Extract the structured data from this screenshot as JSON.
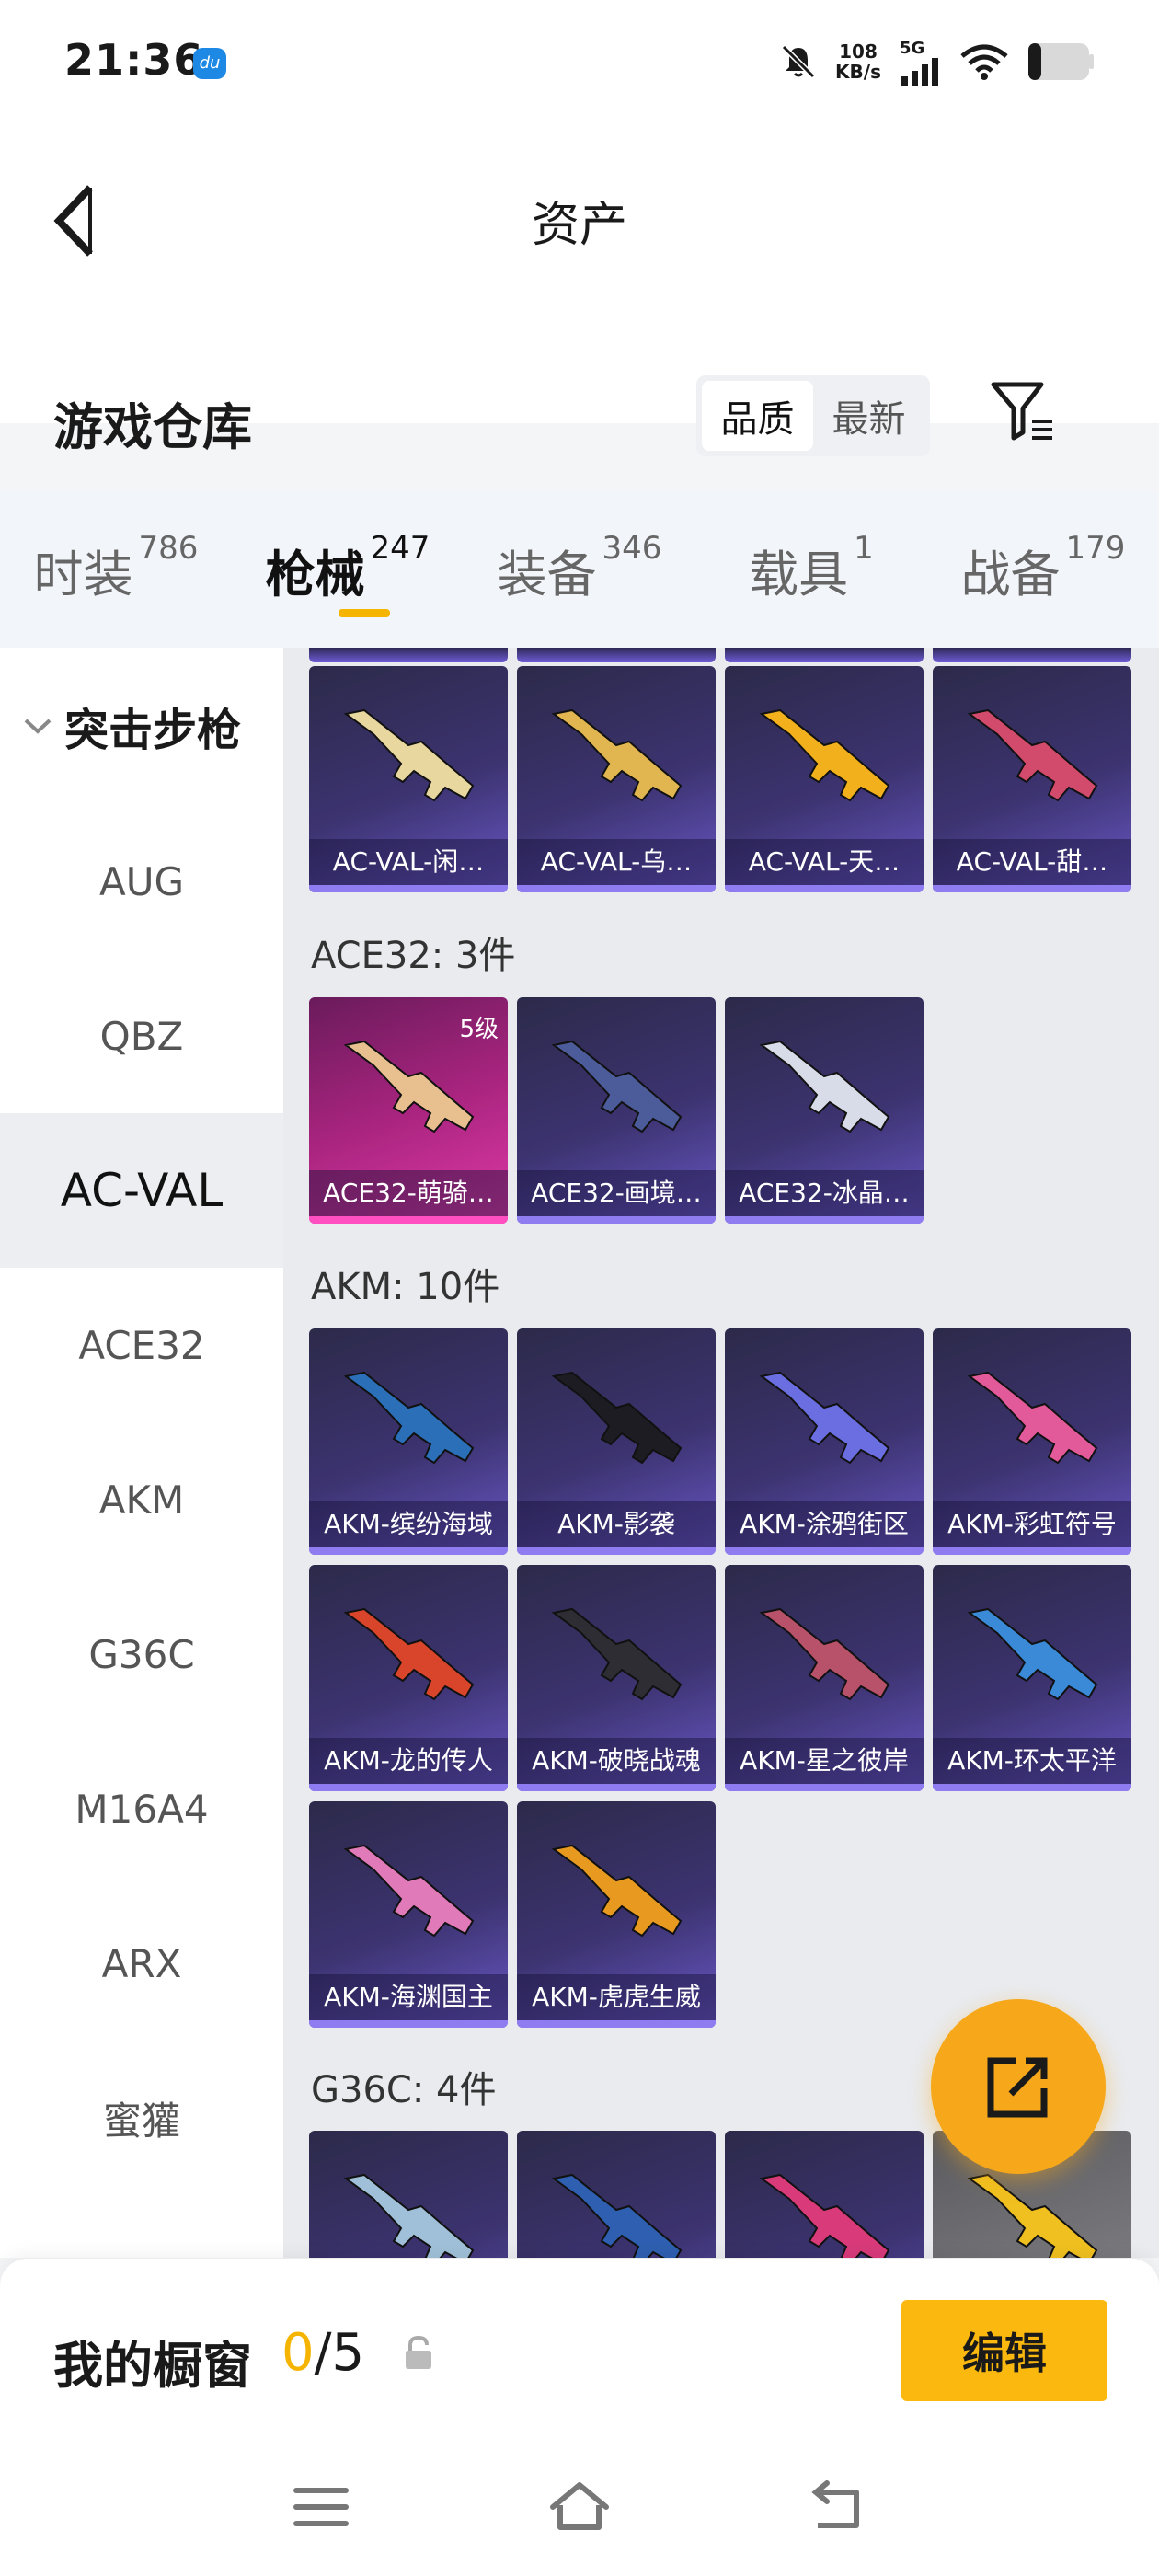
{
  "status_bar": {
    "time": "21:36",
    "net_speed_value": "108",
    "net_speed_unit": "KB/s",
    "network": "5G",
    "app_icon": "du"
  },
  "header": {
    "title": "资产",
    "section_title": "游戏仓库",
    "sort_options": [
      "品质",
      "最新"
    ],
    "active_sort": "品质"
  },
  "tabs": [
    {
      "label": "时装",
      "count": "786"
    },
    {
      "label": "枪械",
      "count": "247"
    },
    {
      "label": "装备",
      "count": "346"
    },
    {
      "label": "载具",
      "count": "1"
    },
    {
      "label": "战备",
      "count": "179"
    }
  ],
  "sidebar": {
    "category": "突击步枪",
    "items": [
      "AUG",
      "QBZ",
      "AC-VAL",
      "ACE32",
      "AKM",
      "G36C",
      "M16A4",
      "ARX",
      "蜜獾"
    ],
    "active": "AC-VAL"
  },
  "groups": {
    "acval": {
      "items": [
        "AC-VAL-闲…",
        "AC-VAL-乌…",
        "AC-VAL-天…",
        "AC-VAL-甜…"
      ]
    },
    "ace32": {
      "title": "ACE32: 3件",
      "items": [
        "ACE32-萌骑…",
        "ACE32-画境…",
        "ACE32-冰晶…"
      ],
      "badge": "5级"
    },
    "akm": {
      "title": "AKM: 10件",
      "items": [
        "AKM-缤纷海域",
        "AKM-影袭",
        "AKM-涂鸦街区",
        "AKM-彩虹符号",
        "AKM-龙的传人",
        "AKM-破晓战魂",
        "AKM-星之彼岸",
        "AKM-环太平洋",
        "AKM-海渊国主",
        "AKM-虎虎生威"
      ]
    },
    "g36c": {
      "title": "G36C: 4件"
    }
  },
  "bottom": {
    "label": "我的橱窗",
    "current": "0",
    "total": "/5",
    "edit": "编辑"
  },
  "colors": {
    "accent": "#f5b400",
    "card_purple": "#3c3370",
    "card_pink": "#a8247e",
    "fab": "#f6a81a"
  },
  "icons": [
    "back-arrow-icon",
    "filter-icon",
    "chevron-down-icon",
    "share-icon",
    "lock-icon",
    "menu-icon",
    "home-icon",
    "back-icon"
  ]
}
